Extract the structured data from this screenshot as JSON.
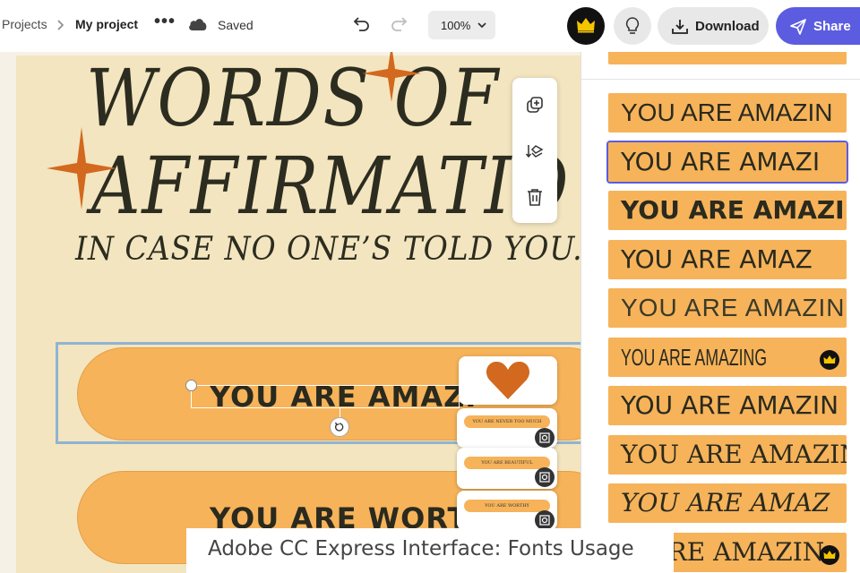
{
  "breadcrumb": {
    "projects": "Projects",
    "separator": ">",
    "current": "My project"
  },
  "header": {
    "more": "•••",
    "saved": "Saved",
    "zoom": "100%",
    "download": "Download",
    "share": "Share"
  },
  "canvas": {
    "title_line1": "WORDS OF",
    "title_line2": "AFFIRMATIO",
    "subtitle": "IN CASE NO ONE’S TOLD YOU...",
    "pill1": "YOU ARE AMAZI",
    "pill2": "YOU ARE WORT",
    "thumbs": [
      "YOU ARE NEVER TOO MUCH",
      "YOU ARE BEAUTIFUL",
      "YOU ARE WORTHY"
    ]
  },
  "font_panel": {
    "tiles": [
      {
        "text": "YOU ARE AMAZIN",
        "font": "Liberation Sans",
        "weight": "normal",
        "style": "normal",
        "premium": false
      },
      {
        "text": "YOU ARE AMAZI",
        "font": "DejaVu Sans",
        "weight": "normal",
        "style": "normal",
        "premium": false
      },
      {
        "text": "YOU ARE AMAZIN",
        "font": "DejaVu Sans",
        "weight": "bold",
        "style": "normal",
        "premium": false
      },
      {
        "text": "YOU ARE AMAZ",
        "font": "DejaVu Sans",
        "weight": "normal",
        "style": "normal",
        "premium": false
      },
      {
        "text": "YOU ARE AMAZIN",
        "font": "Liberation Sans",
        "weight": "normal",
        "style": "normal",
        "premium": false
      },
      {
        "text": "YOU ARE AMAZING",
        "font": "Liberation Sans Narrow",
        "weight": "normal",
        "style": "normal",
        "premium": true
      },
      {
        "text": "YOU ARE AMAZIN",
        "font": "DejaVu Sans",
        "weight": "normal",
        "style": "normal",
        "premium": false
      },
      {
        "text": "YOU ARE AMAZIN",
        "font": "DejaVu Serif",
        "weight": "normal",
        "style": "normal",
        "premium": false
      },
      {
        "text": "YOU ARE AMAZ",
        "font": "DejaVu Serif",
        "weight": "normal",
        "style": "italic",
        "premium": false
      },
      {
        "text": "U ARE AMAZIN",
        "font": "DejaVu Serif",
        "weight": "normal",
        "style": "normal",
        "premium": true
      }
    ]
  },
  "caption": "Adobe CC Express Interface: Fonts Usage",
  "colors": {
    "accent": "#5c5ce0",
    "tile": "#f6b35a",
    "poster_bg": "#f3e5bf",
    "star": "#d2691e",
    "text_dark": "#2c2c20"
  }
}
